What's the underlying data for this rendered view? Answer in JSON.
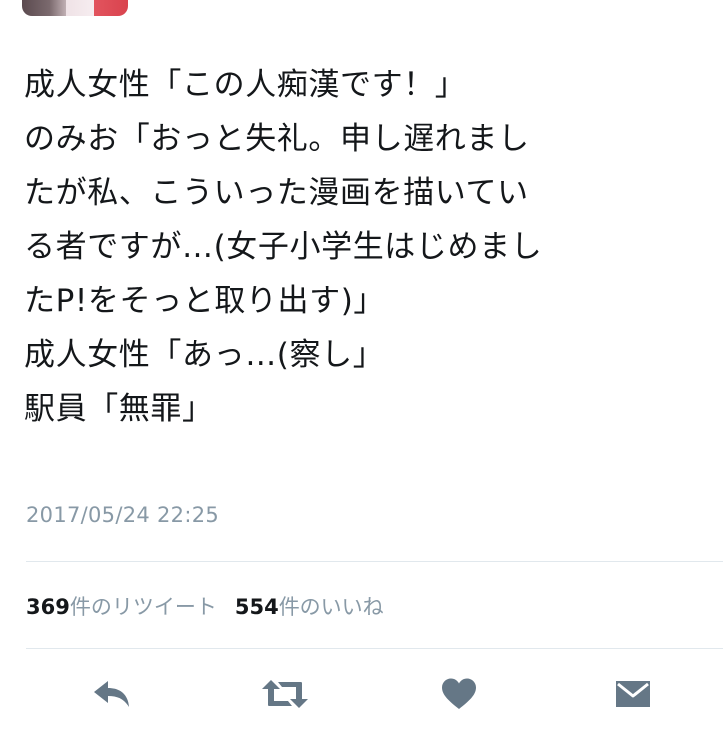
{
  "tweet": {
    "lines": [
      "成人女性「この人痴漢です！」",
      "のみお「おっと失礼。申し遅れまし",
      "たが私、こういった漫画を描いてい",
      "る者ですが…(女子小学生はじめまし",
      "たP!をそっと取り出す)」",
      "成人女性「あっ…(察し」",
      "駅員「無罪」"
    ],
    "timestamp": "2017/05/24 22:25"
  },
  "stats": {
    "retweet_count": "369",
    "retweet_label": "件のリツイート",
    "like_count": "554",
    "like_label": "件のいいね"
  },
  "actions": {
    "icon_color": "#657786",
    "icons": [
      "reply-icon",
      "retweet-icon",
      "like-icon",
      "direct-message-icon"
    ]
  }
}
